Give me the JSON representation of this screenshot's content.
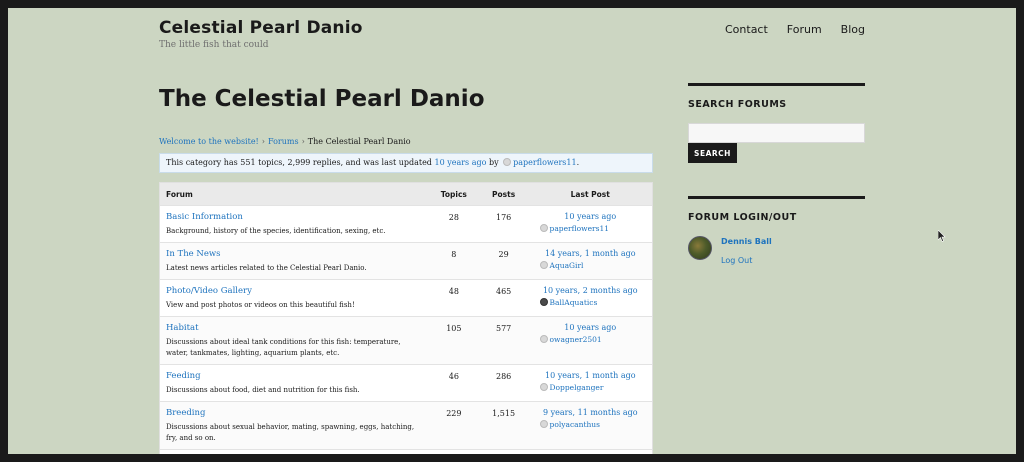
{
  "header": {
    "site_title": "Celestial Pearl Danio",
    "tagline": "The little fish that could",
    "nav": [
      "Contact",
      "Forum",
      "Blog"
    ]
  },
  "page": {
    "title": "The Celestial Pearl Danio",
    "breadcrumb": [
      "Welcome to the website!",
      "Forums",
      "The Celestial Pearl Danio"
    ],
    "notice": {
      "text": "This category has 551 topics, 2,999 replies, and was last updated",
      "time_link": "10 years ago",
      "by": "by",
      "user": "paperflowers11",
      "end": "."
    }
  },
  "forum_table": {
    "headers": [
      "Forum",
      "Topics",
      "Posts",
      "Last Post"
    ],
    "rows": [
      {
        "name": "Basic Information",
        "desc": "Background, history of the species, identification, sexing, etc.",
        "topics": "28",
        "posts": "176",
        "last_time": "10 years ago",
        "last_user": "paperflowers11"
      },
      {
        "name": "In The News",
        "desc": "Latest news articles related to the Celestial Pearl Danio.",
        "topics": "8",
        "posts": "29",
        "last_time": "14 years, 1 month ago",
        "last_user": "AquaGirl"
      },
      {
        "name": "Photo/Video Gallery",
        "desc": "View and post photos or videos on this beautiful fish!",
        "topics": "48",
        "posts": "465",
        "last_time": "10 years, 2 months ago",
        "last_user": "BallAquatics"
      },
      {
        "name": "Habitat",
        "desc": "Discussions about ideal tank conditions for this fish: temperature, water, tankmates, lighting, aquarium plants, etc.",
        "topics": "105",
        "posts": "577",
        "last_time": "10 years ago",
        "last_user": "owagner2501"
      },
      {
        "name": "Feeding",
        "desc": "Discussions about food, diet and nutrition for this fish.",
        "topics": "46",
        "posts": "286",
        "last_time": "10 years, 1 month ago",
        "last_user": "Doppelganger"
      },
      {
        "name": "Breeding",
        "desc": "Discussions about sexual behavior, mating, spawning, eggs, hatching, fry, and so on.",
        "topics": "229",
        "posts": "1,515",
        "last_time": "9 years, 11 months ago",
        "last_user": "polyacanthus"
      }
    ]
  },
  "sidebar": {
    "search_title": "SEARCH FORUMS",
    "search_placeholder": "",
    "search_button": "SEARCH",
    "login_title": "FORUM LOGIN/OUT",
    "user_name": "Dennis Ball",
    "logout": "Log Out"
  },
  "colors": {
    "background": "#ccd6c2",
    "link": "#1e73be",
    "text": "#1a1a1a"
  }
}
